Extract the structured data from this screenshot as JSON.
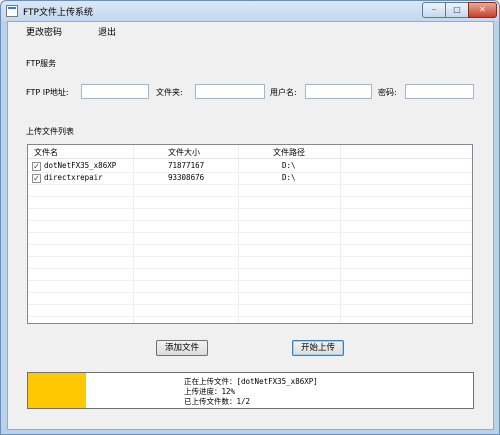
{
  "window": {
    "title": "FTP文件上传系统",
    "min": "–",
    "max": "□",
    "close": "✕"
  },
  "menu": {
    "change_password": "更改密码",
    "exit": "退出"
  },
  "ftp": {
    "section": "FTP服务",
    "ip_label": "FTP IP地址:",
    "folder_label": "文件夹:",
    "user_label": "用户名:",
    "pass_label": "密码:",
    "ip_value": "",
    "folder_value": "",
    "user_value": "",
    "pass_value": ""
  },
  "list": {
    "section": "上传文件列表",
    "headers": [
      "文件名",
      "文件大小",
      "文件路径"
    ],
    "rows": [
      {
        "checked": true,
        "name": "dotNetFX35_x86XP",
        "size": "71877167",
        "path": "D:\\"
      },
      {
        "checked": true,
        "name": "directxrepair",
        "size": "93308676",
        "path": "D:\\"
      }
    ]
  },
  "buttons": {
    "add": "添加文件",
    "start": "开始上传"
  },
  "status": {
    "progress": 0.12,
    "progress_color": "#ffc800",
    "uploading": "正在上传文件：[dotNetFX35_x86XP]",
    "progress_text": "上传进度：12%",
    "uploaded_count": "已上传文件数：1/2"
  }
}
